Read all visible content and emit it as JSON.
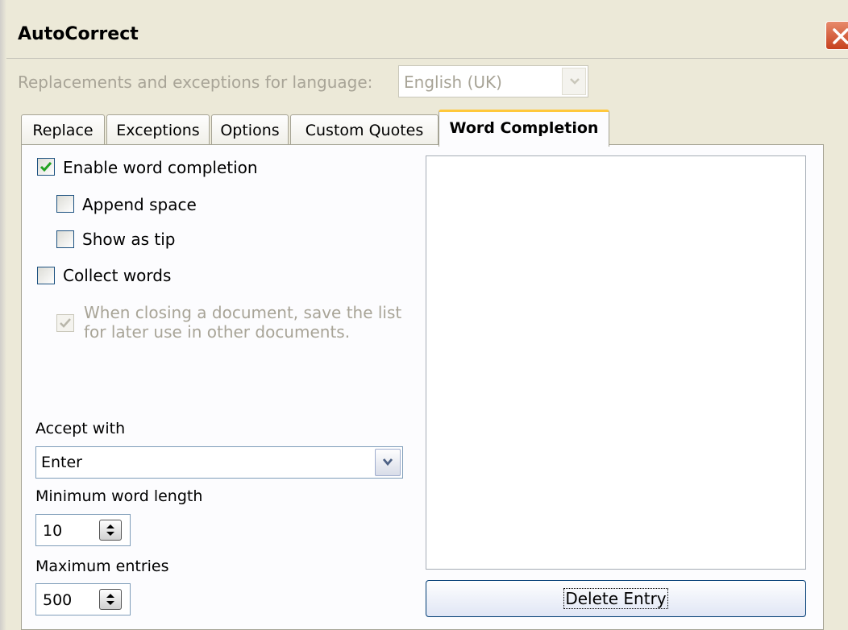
{
  "window": {
    "title": "AutoCorrect"
  },
  "language": {
    "label": "Replacements and exceptions for language:",
    "value": "English (UK)"
  },
  "tabs": [
    {
      "label": "Replace"
    },
    {
      "label": "Exceptions"
    },
    {
      "label": "Options"
    },
    {
      "label": "Custom Quotes"
    },
    {
      "label": "Word Completion",
      "active": true
    }
  ],
  "options": {
    "enable_word_completion": {
      "label": "Enable word completion",
      "checked": true
    },
    "append_space": {
      "label": "Append space",
      "checked": false
    },
    "show_as_tip": {
      "label": "Show as tip",
      "checked": false
    },
    "collect_words": {
      "label": "Collect words",
      "checked": false
    },
    "save_list": {
      "label_line1": "When closing a document, save the list",
      "label_line2": "for later use in other documents.",
      "checked": true,
      "disabled": true
    }
  },
  "accept_with": {
    "label": "Accept with",
    "value": "Enter"
  },
  "min_word_length": {
    "label": "Minimum word length",
    "value": "10"
  },
  "max_entries": {
    "label": "Maximum entries",
    "value": "500"
  },
  "word_list": {
    "entries": []
  },
  "delete_button": {
    "label": "Delete Entry"
  },
  "colors": {
    "dialog_bg": "#ece9d8",
    "panel_bg": "#fcfcfe",
    "active_tab_accent": "#ffc83c",
    "close_button": "#c6401e",
    "checkmark": "#21a121",
    "disabled_text": "#a8a497"
  }
}
